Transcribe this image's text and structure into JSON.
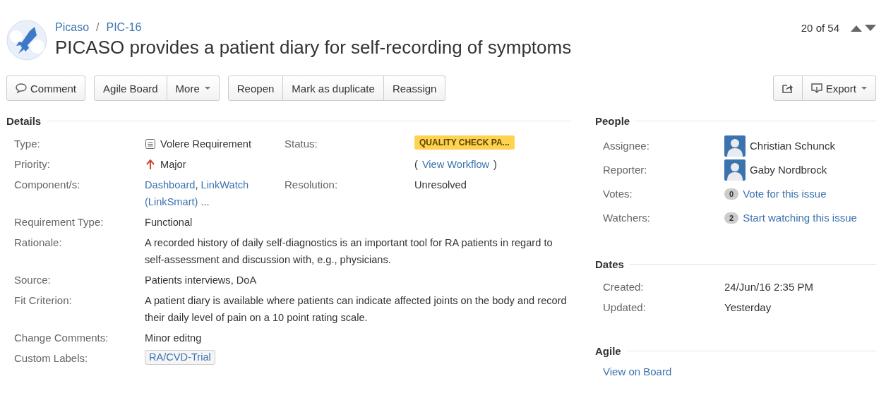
{
  "breadcrumb": {
    "items": [
      "Picaso",
      "PIC-16"
    ],
    "separator": "/"
  },
  "title": "PICASO provides a patient diary for self-recording of symptoms",
  "pager": {
    "text": "20 of 54"
  },
  "toolbar": {
    "left": [
      [
        {
          "kind": "comment",
          "label": "Comment"
        }
      ],
      [
        {
          "kind": "plain",
          "label": "Agile Board"
        },
        {
          "kind": "dropdown",
          "label": "More"
        }
      ],
      [
        {
          "kind": "plain",
          "label": "Reopen"
        },
        {
          "kind": "plain",
          "label": "Mark as duplicate"
        },
        {
          "kind": "plain",
          "label": "Reassign"
        }
      ]
    ],
    "right": [
      [
        {
          "kind": "share"
        },
        {
          "kind": "export",
          "label": "Export"
        }
      ]
    ]
  },
  "details": {
    "heading": "Details",
    "left": [
      {
        "label": "Type:",
        "kind": "type",
        "value": "Volere Requirement"
      },
      {
        "label": "Priority:",
        "kind": "priority",
        "value": "Major"
      },
      {
        "label": "Component/s:",
        "kind": "links",
        "links": [
          "Dashboard",
          "LinkWatch (LinkSmart)"
        ],
        "separator": ",",
        "more": "..."
      }
    ],
    "right": [
      {
        "label": "Status:",
        "kind": "status",
        "value": "QUALITY CHECK PA..."
      },
      {
        "kind": "workflow",
        "prefix": "(",
        "link": "View Workflow",
        "suffix": ")"
      },
      {
        "label": "Resolution:",
        "kind": "text",
        "value": "Unresolved"
      }
    ],
    "rows": [
      {
        "label": "Requirement Type:",
        "kind": "text",
        "value": "Functional"
      },
      {
        "label": "Rationale:",
        "kind": "text",
        "value": "A recorded history of daily self-diagnostics is an important tool for RA patients in regard to self-assessment and discussion with, e.g., physicians."
      },
      {
        "label": "Source:",
        "kind": "text",
        "value": "Patients interviews, DoA"
      },
      {
        "label": "Fit Criterion:",
        "kind": "text",
        "value": "A patient diary is available where patients can indicate affected joints on the body and record their daily level of pain on a 10 point rating scale."
      },
      {
        "label": "Change Comments:",
        "kind": "text",
        "value": "Minor editng"
      },
      {
        "label": "Custom Labels:",
        "kind": "label",
        "value": "RA/CVD-Trial"
      }
    ]
  },
  "people": {
    "heading": "People",
    "rows": [
      {
        "label": "Assignee:",
        "kind": "user",
        "value": "Christian Schunck"
      },
      {
        "label": "Reporter:",
        "kind": "user",
        "value": "Gaby Nordbrock"
      },
      {
        "label": "Votes:",
        "kind": "count",
        "count": "0",
        "link": "Vote for this issue"
      },
      {
        "label": "Watchers:",
        "kind": "count",
        "count": "2",
        "link": "Start watching this issue"
      }
    ]
  },
  "dates": {
    "heading": "Dates",
    "rows": [
      {
        "label": "Created:",
        "value": "24/Jun/16 2:35 PM"
      },
      {
        "label": "Updated:",
        "value": "Yesterday"
      }
    ]
  },
  "agile": {
    "heading": "Agile",
    "link": "View on Board"
  }
}
